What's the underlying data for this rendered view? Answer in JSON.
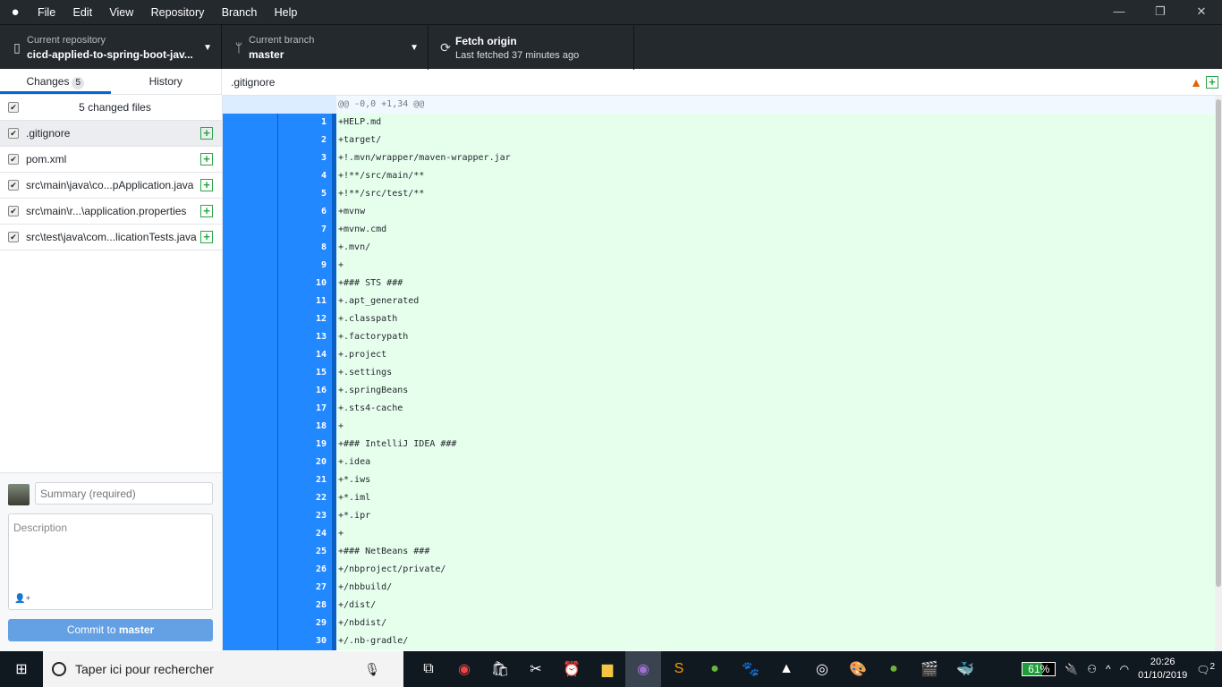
{
  "menu": [
    "File",
    "Edit",
    "View",
    "Repository",
    "Branch",
    "Help"
  ],
  "toolbar": {
    "repo": {
      "label": "Current repository",
      "value": "cicd-applied-to-spring-boot-jav..."
    },
    "branch": {
      "label": "Current branch",
      "value": "master"
    },
    "fetch": {
      "label": "Fetch origin",
      "value": "Last fetched 37 minutes ago"
    }
  },
  "tabs": {
    "changes": "Changes",
    "changes_count": "5",
    "history": "History"
  },
  "changes": {
    "summary": "5 changed files",
    "files": [
      ".gitignore",
      "pom.xml",
      "src\\main\\java\\co...pApplication.java",
      "src\\main\\r...\\application.properties",
      "src\\test\\java\\com...licationTests.java"
    ]
  },
  "commit": {
    "summary_placeholder": "Summary (required)",
    "description_placeholder": "Description",
    "button_prefix": "Commit to ",
    "button_branch": "master"
  },
  "diff": {
    "file": ".gitignore",
    "hunk": "@@ -0,0 +1,34 @@",
    "lines": [
      "+HELP.md",
      "+target/",
      "+!.mvn/wrapper/maven-wrapper.jar",
      "+!**/src/main/**",
      "+!**/src/test/**",
      "+mvnw",
      "+mvnw.cmd",
      "+.mvn/",
      "+",
      "+### STS ###",
      "+.apt_generated",
      "+.classpath",
      "+.factorypath",
      "+.project",
      "+.settings",
      "+.springBeans",
      "+.sts4-cache",
      "+",
      "+### IntelliJ IDEA ###",
      "+.idea",
      "+*.iws",
      "+*.iml",
      "+*.ipr",
      "+",
      "+### NetBeans ###",
      "+/nbproject/private/",
      "+/nbbuild/",
      "+/dist/",
      "+/nbdist/",
      "+/.nb-gradle/"
    ]
  },
  "taskbar": {
    "search": "Taper ici pour rechercher",
    "battery": "61%",
    "time": "20:26",
    "date": "01/10/2019",
    "notifications": "2"
  }
}
